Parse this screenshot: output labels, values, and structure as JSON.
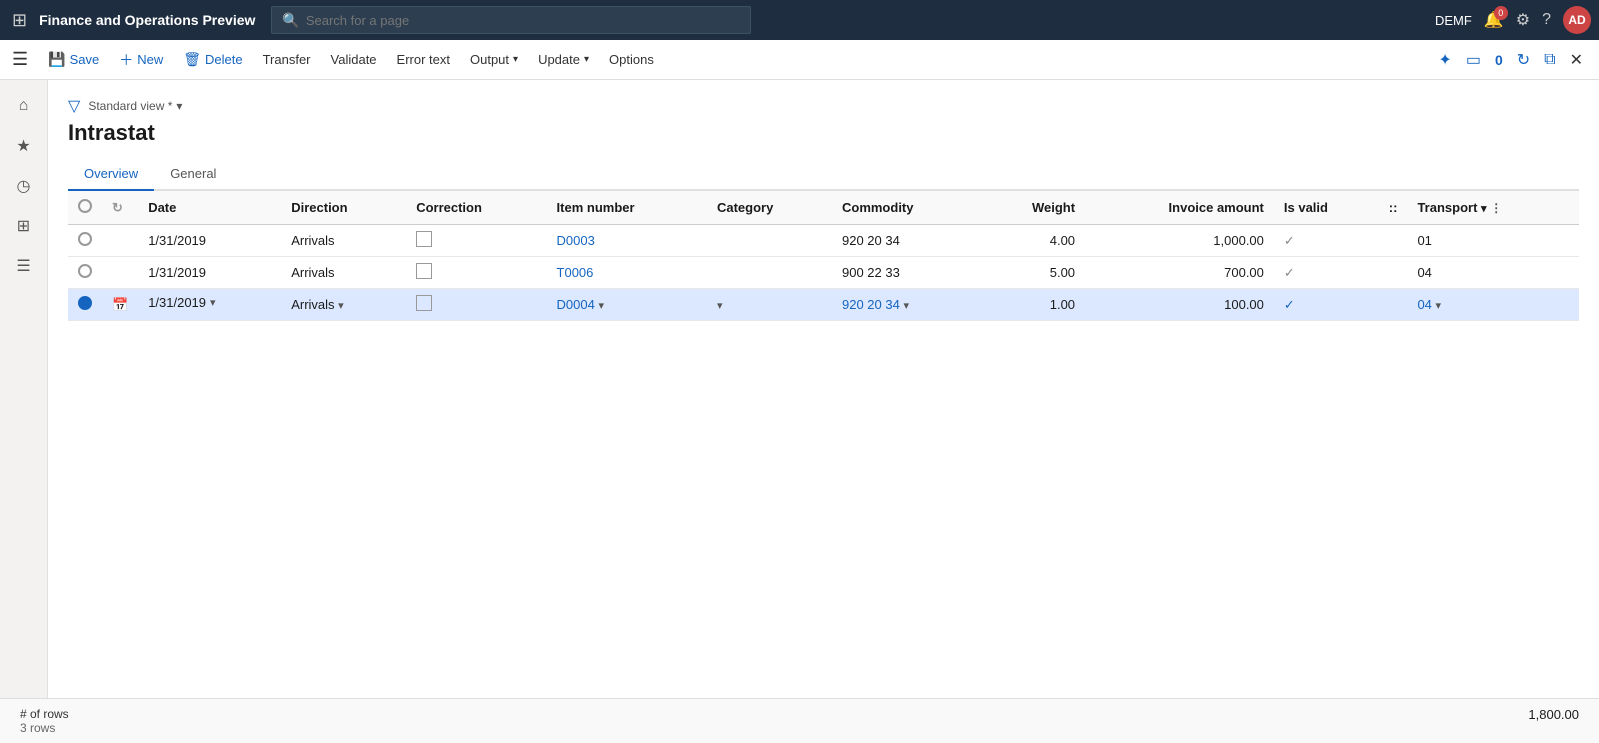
{
  "app": {
    "title": "Finance and Operations Preview"
  },
  "topnav": {
    "search_placeholder": "Search for a page",
    "env_label": "DEMF",
    "notification_badge": "0",
    "avatar_initials": "AD"
  },
  "toolbar": {
    "save_label": "Save",
    "new_label": "New",
    "delete_label": "Delete",
    "transfer_label": "Transfer",
    "validate_label": "Validate",
    "error_text_label": "Error text",
    "output_label": "Output",
    "update_label": "Update",
    "options_label": "Options"
  },
  "sidebar": {
    "items": [
      {
        "name": "home",
        "icon": "⌂"
      },
      {
        "name": "favorites",
        "icon": "★"
      },
      {
        "name": "recent",
        "icon": "◷"
      },
      {
        "name": "workspaces",
        "icon": "⊞"
      },
      {
        "name": "modules",
        "icon": "☰"
      }
    ]
  },
  "page": {
    "view_label": "Standard view *",
    "title": "Intrastat",
    "tabs": [
      {
        "label": "Overview",
        "active": true
      },
      {
        "label": "General",
        "active": false
      }
    ]
  },
  "table": {
    "columns": [
      {
        "key": "select",
        "label": ""
      },
      {
        "key": "refresh",
        "label": ""
      },
      {
        "key": "date",
        "label": "Date"
      },
      {
        "key": "direction",
        "label": "Direction"
      },
      {
        "key": "correction",
        "label": "Correction"
      },
      {
        "key": "item_number",
        "label": "Item number"
      },
      {
        "key": "category",
        "label": "Category"
      },
      {
        "key": "commodity",
        "label": "Commodity"
      },
      {
        "key": "weight",
        "label": "Weight",
        "align": "right"
      },
      {
        "key": "invoice_amount",
        "label": "Invoice amount",
        "align": "right"
      },
      {
        "key": "is_valid",
        "label": "Is valid"
      },
      {
        "key": "transport_handle",
        "label": "::"
      },
      {
        "key": "transport",
        "label": "Transport"
      }
    ],
    "rows": [
      {
        "selected": false,
        "date": "1/31/2019",
        "direction": "Arrivals",
        "correction": false,
        "item_number": "D0003",
        "category": "",
        "commodity": "920 20 34",
        "weight": "4.00",
        "invoice_amount": "1,000.00",
        "is_valid": true,
        "transport": "01"
      },
      {
        "selected": false,
        "date": "1/31/2019",
        "direction": "Arrivals",
        "correction": false,
        "item_number": "T0006",
        "category": "",
        "commodity": "900 22 33",
        "weight": "5.00",
        "invoice_amount": "700.00",
        "is_valid": true,
        "transport": "04"
      },
      {
        "selected": true,
        "date": "1/31/2019",
        "direction": "Arrivals",
        "correction": false,
        "item_number": "D0004",
        "category": "",
        "commodity": "920 20 34",
        "weight": "1.00",
        "invoice_amount": "100.00",
        "is_valid": true,
        "transport": "04"
      }
    ]
  },
  "footer": {
    "rows_label": "# of rows",
    "rows_count": "3 rows",
    "total_amount": "1,800.00"
  }
}
